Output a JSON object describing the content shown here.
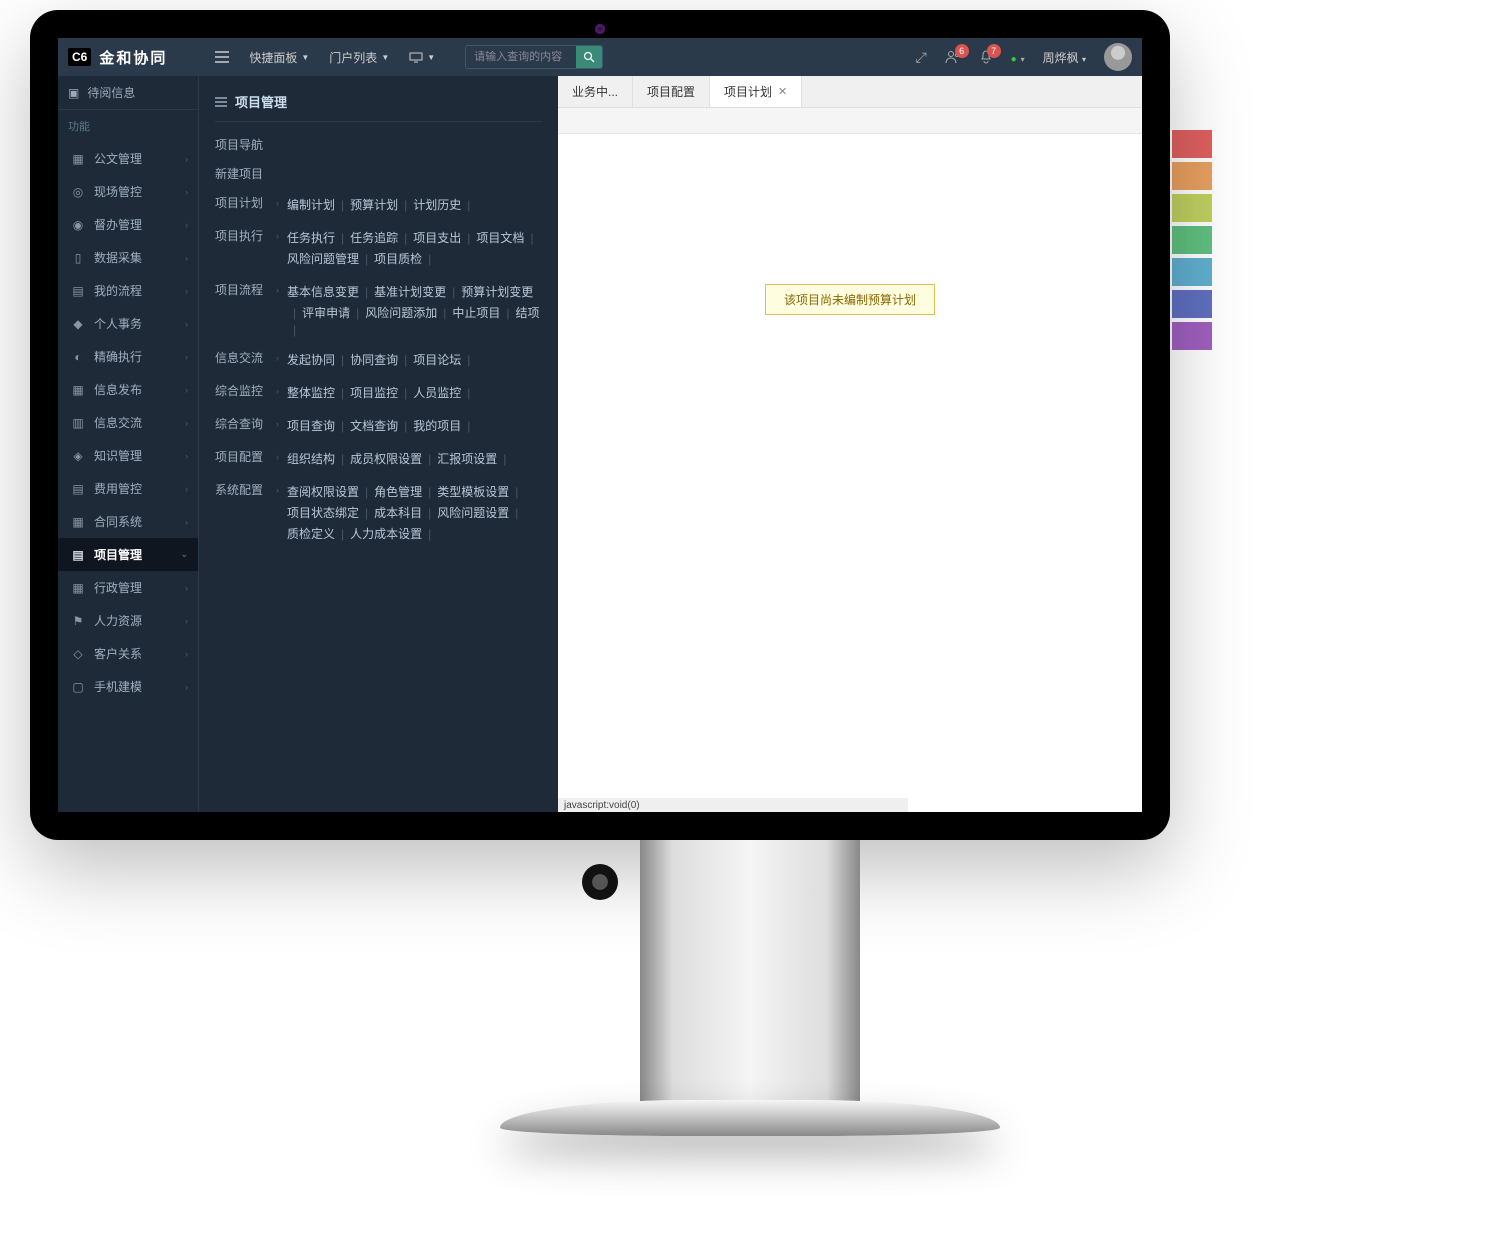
{
  "brand": {
    "badge": "C6",
    "title": "金和协同"
  },
  "topnav": {
    "items": [
      "快捷面板",
      "门户列表"
    ],
    "search_placeholder": "请输入查询的内容"
  },
  "notifications": {
    "users_badge": "6",
    "bell_badge": "7"
  },
  "user": {
    "name": "周烨枫"
  },
  "sidebar": {
    "top_item": "待阅信息",
    "section_label": "功能",
    "items": [
      "公文管理",
      "现场管控",
      "督办管理",
      "数据采集",
      "我的流程",
      "个人事务",
      "精确执行",
      "信息发布",
      "信息交流",
      "知识管理",
      "费用管控",
      "合同系统",
      "项目管理",
      "行政管理",
      "人力资源",
      "客户关系",
      "手机建模"
    ],
    "active_index": 12
  },
  "flyout": {
    "title": "项目管理",
    "groups": [
      {
        "label": "项目导航",
        "links": []
      },
      {
        "label": "新建项目",
        "links": []
      },
      {
        "label": "项目计划",
        "links": [
          "编制计划",
          "预算计划",
          "计划历史"
        ]
      },
      {
        "label": "项目执行",
        "links": [
          "任务执行",
          "任务追踪",
          "项目支出",
          "项目文档",
          "风险问题管理",
          "项目质检"
        ]
      },
      {
        "label": "项目流程",
        "links": [
          "基本信息变更",
          "基准计划变更",
          "预算计划变更",
          "评审申请",
          "风险问题添加",
          "中止项目",
          "结项"
        ]
      },
      {
        "label": "信息交流",
        "links": [
          "发起协同",
          "协同查询",
          "项目论坛"
        ]
      },
      {
        "label": "综合监控",
        "links": [
          "整体监控",
          "项目监控",
          "人员监控"
        ]
      },
      {
        "label": "综合查询",
        "links": [
          "项目查询",
          "文档查询",
          "我的项目"
        ]
      },
      {
        "label": "项目配置",
        "links": [
          "组织结构",
          "成员权限设置",
          "汇报项设置"
        ]
      },
      {
        "label": "系统配置",
        "links": [
          "查阅权限设置",
          "角色管理",
          "类型模板设置",
          "项目状态绑定",
          "成本科目",
          "风险问题设置",
          "质检定义",
          "人力成本设置"
        ]
      }
    ]
  },
  "tabs": {
    "items": [
      {
        "label": "业务中...",
        "closable": false
      },
      {
        "label": "项目配置",
        "closable": false
      },
      {
        "label": "项目计划",
        "closable": true,
        "active": true
      }
    ]
  },
  "notice_text": "该项目尚未编制预算计划",
  "statusbar": "javascript:void(0)"
}
